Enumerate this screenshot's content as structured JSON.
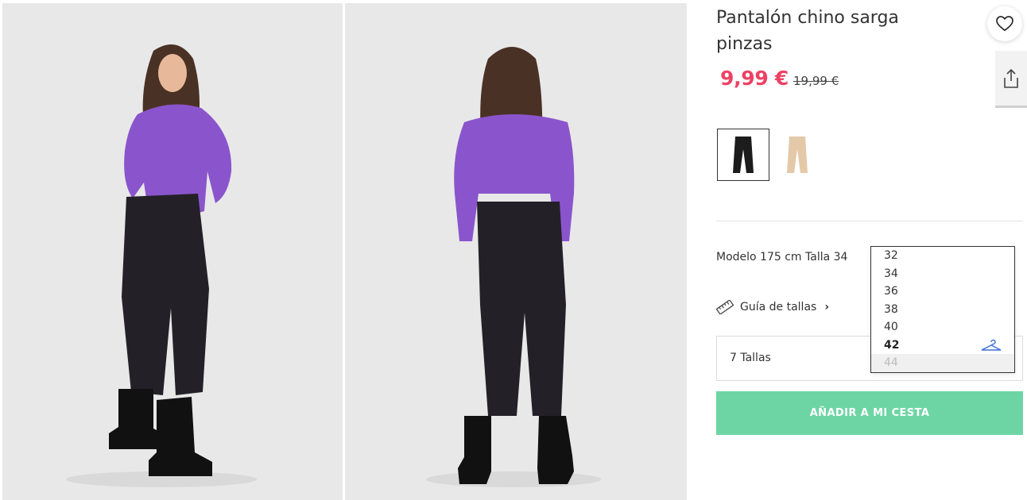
{
  "product": {
    "title": "Pantalón chino sarga pinzas",
    "price_current": "9,99 €",
    "price_original": "19,99 €",
    "model_info": "Modelo 175 cm Talla 34",
    "size_guide_label": "Guía de tallas",
    "sizes_count_label": "7 Tallas",
    "add_to_cart_label": "AÑADIR A MI CESTA"
  },
  "sizes": {
    "options": [
      "32",
      "34",
      "36",
      "38",
      "40",
      "42",
      "44"
    ],
    "selected": "42"
  },
  "colors": {
    "price_accent": "#ee4163",
    "add_button": "#6dd5a4",
    "hanger_icon": "#3b6fd8"
  },
  "swatches": [
    {
      "name": "black",
      "color": "#1c1c1c",
      "selected": true
    },
    {
      "name": "beige",
      "color": "#e3c9a8",
      "selected": false
    }
  ],
  "icons": {
    "favorite": "heart-icon",
    "share": "share-icon",
    "size_guide": "ruler-icon",
    "fitting": "hanger-icon"
  }
}
